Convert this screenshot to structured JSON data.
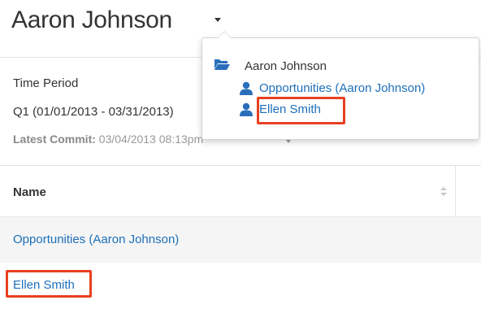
{
  "header": {
    "title": "Aaron Johnson"
  },
  "filters": {
    "time_period_label": "Time Period",
    "time_period_value": "Q1 (01/01/2013 - 03/31/2013)",
    "latest_commit_label": "Latest Commit:",
    "latest_commit_value": "03/04/2013 08:13pm"
  },
  "table": {
    "columns": [
      "Name"
    ],
    "rows": [
      {
        "name": "Opportunities (Aaron Johnson)"
      },
      {
        "name": "Ellen Smith"
      }
    ]
  },
  "dropdown": {
    "root": {
      "label": "Aaron Johnson",
      "icon": "folder-open-icon"
    },
    "children": [
      {
        "label": "Opportunities (Aaron Johnson)",
        "icon": "user-icon"
      },
      {
        "label": "Ellen Smith",
        "icon": "user-icon"
      }
    ]
  },
  "colors": {
    "link": "#1d6fba",
    "highlight": "#e8401f",
    "icon": "#2a6ebb"
  }
}
